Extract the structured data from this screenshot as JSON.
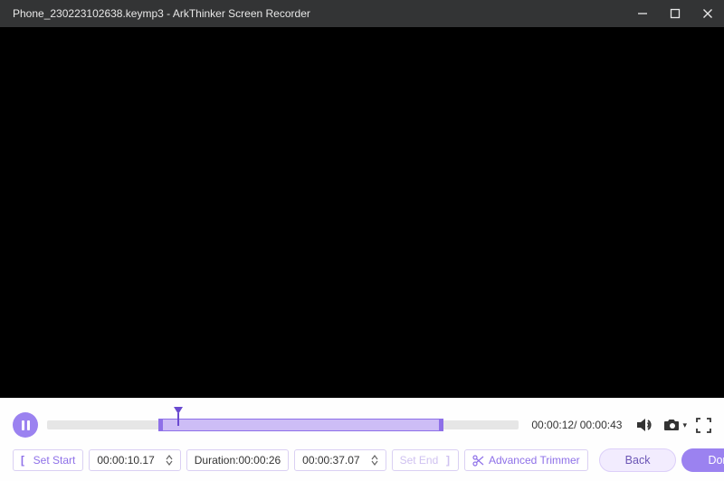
{
  "titlebar": {
    "title": "Phone_230223102638.keymp3  -  ArkThinker Screen Recorder"
  },
  "playback": {
    "track": {
      "sel_left_pct": 23.6,
      "sel_width_pct": 60.5,
      "playhead_pct": 27.8
    },
    "time_label": "00:00:12/ 00:00:43"
  },
  "trimbar": {
    "set_start_label": "Set Start",
    "start_time": "00:00:10.17",
    "duration_label": "Duration:00:00:26",
    "end_time": "00:00:37.07",
    "set_end_label": "Set End",
    "advanced_trimmer_label": "Advanced Trimmer",
    "back_label": "Back",
    "done_label": "Done"
  }
}
